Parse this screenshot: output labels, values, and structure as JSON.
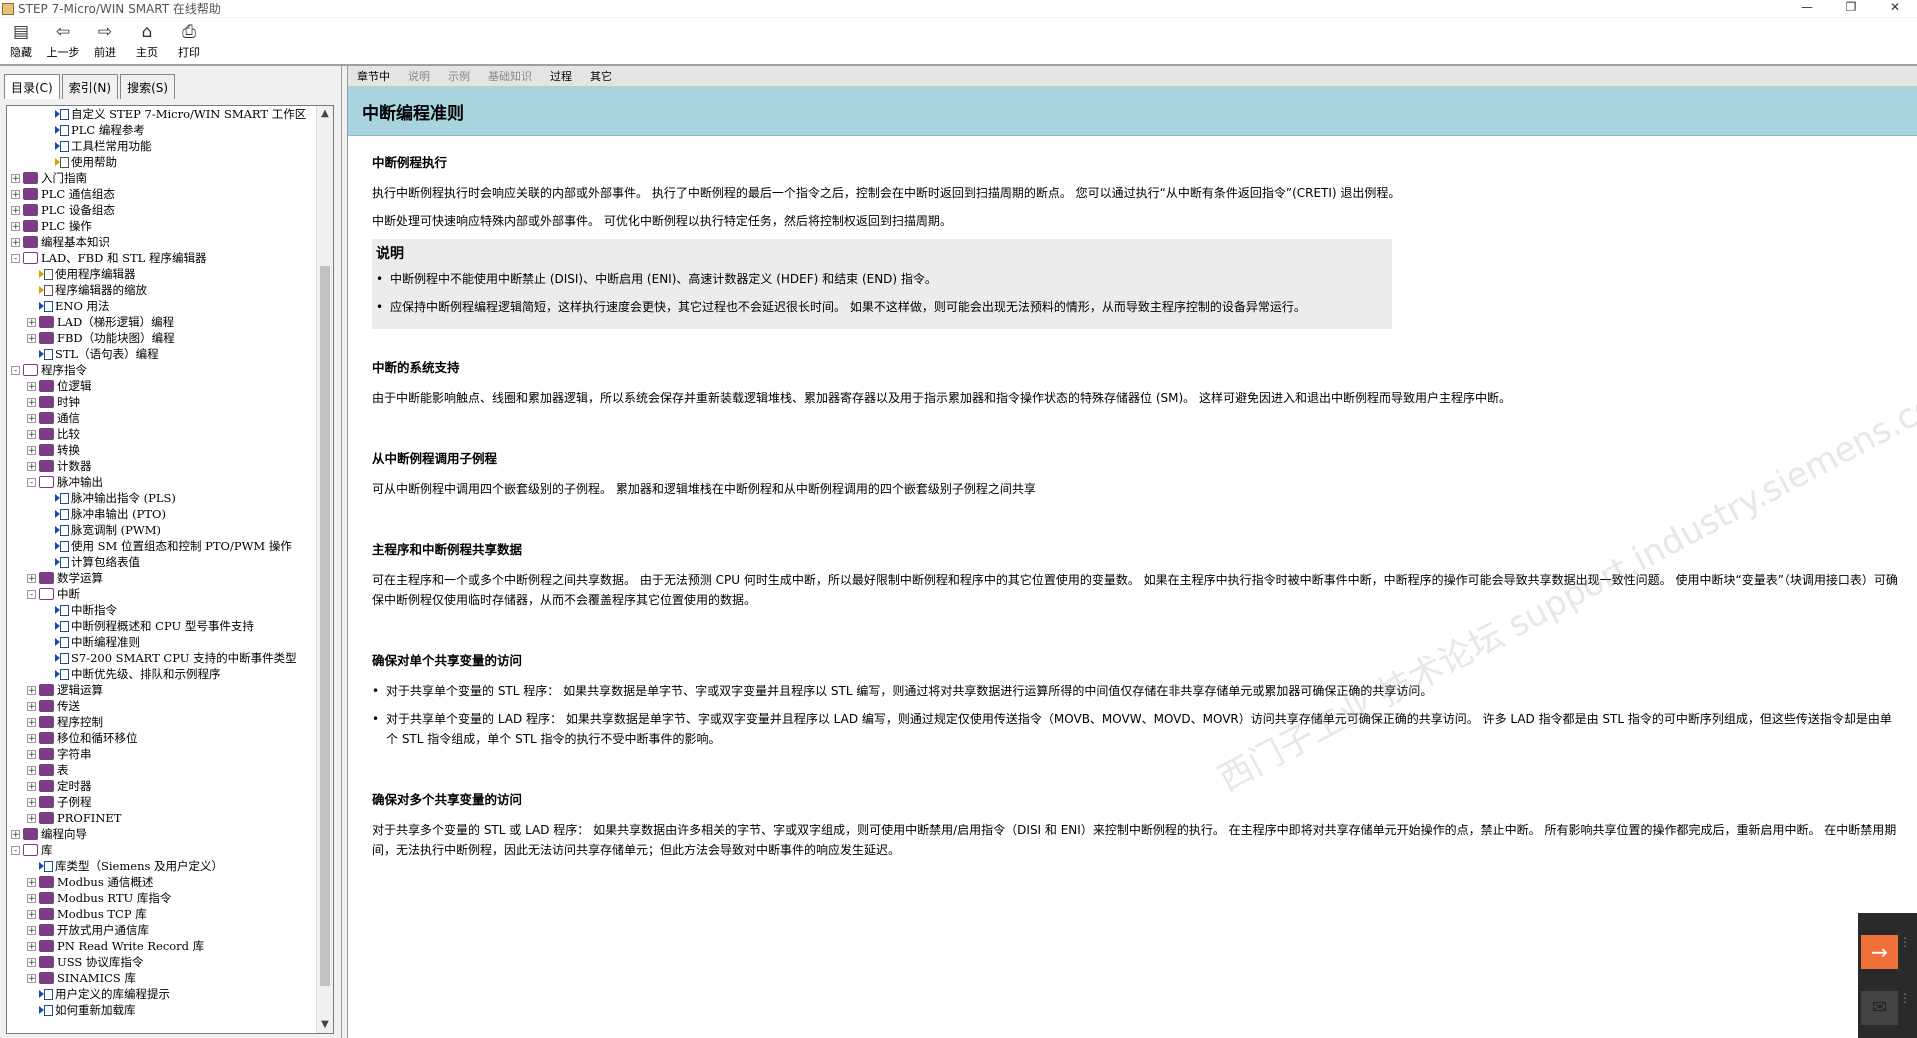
{
  "window": {
    "title": "STEP 7-Micro/WIN SMART 在线帮助",
    "controls": [
      "—",
      "❐",
      "✕"
    ]
  },
  "toolbar": {
    "buttons": [
      {
        "label": "隐藏",
        "icon": "hide-icon"
      },
      {
        "label": "上一步",
        "icon": "back-icon"
      },
      {
        "label": "前进",
        "icon": "forward-icon"
      },
      {
        "label": "主页",
        "icon": "home-icon"
      },
      {
        "label": "打印",
        "icon": "print-icon"
      }
    ]
  },
  "left_tabs": [
    "目录(C)",
    "索引(N)",
    "搜索(S)"
  ],
  "tree": [
    {
      "level": 3,
      "type": "page",
      "exp": "",
      "label": "自定义 STEP 7-Micro/WIN SMART 工作区"
    },
    {
      "level": 3,
      "type": "page",
      "exp": "",
      "label": "PLC 编程参考"
    },
    {
      "level": 3,
      "type": "page",
      "exp": "",
      "label": "工具栏常用功能"
    },
    {
      "level": 3,
      "type": "yellow",
      "exp": "",
      "label": "使用帮助"
    },
    {
      "level": 1,
      "type": "book",
      "exp": "+",
      "label": "入门指南"
    },
    {
      "level": 1,
      "type": "book",
      "exp": "+",
      "label": "PLC 通信组态"
    },
    {
      "level": 1,
      "type": "book",
      "exp": "+",
      "label": "PLC 设备组态"
    },
    {
      "level": 1,
      "type": "book",
      "exp": "+",
      "label": "PLC 操作"
    },
    {
      "level": 1,
      "type": "book",
      "exp": "+",
      "label": "编程基本知识"
    },
    {
      "level": 1,
      "type": "openbook",
      "exp": "-",
      "label": "LAD、FBD 和 STL 程序编辑器"
    },
    {
      "level": 2,
      "type": "yellow",
      "exp": "",
      "label": "使用程序编辑器"
    },
    {
      "level": 2,
      "type": "yellow",
      "exp": "",
      "label": "程序编辑器的缩放"
    },
    {
      "level": 2,
      "type": "page",
      "exp": "",
      "label": "ENO 用法"
    },
    {
      "level": 2,
      "type": "book",
      "exp": "+",
      "label": "LAD（梯形逻辑）编程"
    },
    {
      "level": 2,
      "type": "book",
      "exp": "+",
      "label": "FBD（功能块图）编程"
    },
    {
      "level": 2,
      "type": "page",
      "exp": "",
      "label": "STL（语句表）编程"
    },
    {
      "level": 1,
      "type": "openbook",
      "exp": "-",
      "label": "程序指令"
    },
    {
      "level": 2,
      "type": "book",
      "exp": "+",
      "label": "位逻辑"
    },
    {
      "level": 2,
      "type": "book",
      "exp": "+",
      "label": "时钟"
    },
    {
      "level": 2,
      "type": "book",
      "exp": "+",
      "label": "通信"
    },
    {
      "level": 2,
      "type": "book",
      "exp": "+",
      "label": "比较"
    },
    {
      "level": 2,
      "type": "book",
      "exp": "+",
      "label": "转换"
    },
    {
      "level": 2,
      "type": "book",
      "exp": "+",
      "label": "计数器"
    },
    {
      "level": 2,
      "type": "openbook",
      "exp": "-",
      "label": "脉冲输出"
    },
    {
      "level": 3,
      "type": "page",
      "exp": "",
      "label": "脉冲输出指令 (PLS)"
    },
    {
      "level": 3,
      "type": "page",
      "exp": "",
      "label": "脉冲串输出 (PTO)"
    },
    {
      "level": 3,
      "type": "page",
      "exp": "",
      "label": "脉宽调制 (PWM)"
    },
    {
      "level": 3,
      "type": "page",
      "exp": "",
      "label": "使用 SM 位置组态和控制 PTO/PWM 操作"
    },
    {
      "level": 3,
      "type": "page",
      "exp": "",
      "label": "计算包络表值"
    },
    {
      "level": 2,
      "type": "book",
      "exp": "+",
      "label": "数学运算"
    },
    {
      "level": 2,
      "type": "openbook",
      "exp": "-",
      "label": "中断"
    },
    {
      "level": 3,
      "type": "page",
      "exp": "",
      "label": "中断指令"
    },
    {
      "level": 3,
      "type": "page",
      "exp": "",
      "label": "中断例程概述和 CPU 型号事件支持"
    },
    {
      "level": 3,
      "type": "page",
      "exp": "",
      "label": "中断编程准则"
    },
    {
      "level": 3,
      "type": "page",
      "exp": "",
      "label": "S7-200 SMART CPU 支持的中断事件类型"
    },
    {
      "level": 3,
      "type": "page",
      "exp": "",
      "label": "中断优先级、排队和示例程序"
    },
    {
      "level": 2,
      "type": "book",
      "exp": "+",
      "label": "逻辑运算"
    },
    {
      "level": 2,
      "type": "book",
      "exp": "+",
      "label": "传送"
    },
    {
      "level": 2,
      "type": "book",
      "exp": "+",
      "label": "程序控制"
    },
    {
      "level": 2,
      "type": "book",
      "exp": "+",
      "label": "移位和循环移位"
    },
    {
      "level": 2,
      "type": "book",
      "exp": "+",
      "label": "字符串"
    },
    {
      "level": 2,
      "type": "book",
      "exp": "+",
      "label": "表"
    },
    {
      "level": 2,
      "type": "book",
      "exp": "+",
      "label": "定时器"
    },
    {
      "level": 2,
      "type": "book",
      "exp": "+",
      "label": "子例程"
    },
    {
      "level": 2,
      "type": "book",
      "exp": "+",
      "label": "PROFINET"
    },
    {
      "level": 1,
      "type": "book",
      "exp": "+",
      "label": "编程向导"
    },
    {
      "level": 1,
      "type": "openbook",
      "exp": "-",
      "label": "库"
    },
    {
      "level": 2,
      "type": "page",
      "exp": "",
      "label": "库类型（Siemens 及用户定义）"
    },
    {
      "level": 2,
      "type": "book",
      "exp": "+",
      "label": "Modbus 通信概述"
    },
    {
      "level": 2,
      "type": "book",
      "exp": "+",
      "label": "Modbus RTU 库指令"
    },
    {
      "level": 2,
      "type": "book",
      "exp": "+",
      "label": "Modbus TCP 库"
    },
    {
      "level": 2,
      "type": "book",
      "exp": "+",
      "label": "开放式用户通信库"
    },
    {
      "level": 2,
      "type": "book",
      "exp": "+",
      "label": "PN Read Write Record 库"
    },
    {
      "level": 2,
      "type": "book",
      "exp": "+",
      "label": "USS 协议库指令"
    },
    {
      "level": 2,
      "type": "book",
      "exp": "+",
      "label": "SINAMICS 库"
    },
    {
      "level": 2,
      "type": "page",
      "exp": "",
      "label": "用户定义的库编程提示"
    },
    {
      "level": 2,
      "type": "page",
      "exp": "",
      "label": "如何重新加载库"
    }
  ],
  "content_tabs": [
    {
      "label": "章节中",
      "active": true
    },
    {
      "label": "说明",
      "active": false
    },
    {
      "label": "示例",
      "active": false
    },
    {
      "label": "基础知识",
      "active": false
    },
    {
      "label": "过程",
      "active": true
    },
    {
      "label": "其它",
      "active": true
    }
  ],
  "page_title": "中断编程准则",
  "sections": {
    "s1_title": "中断例程执行",
    "s1_p1": "执行中断例程执行时会响应关联的内部或外部事件。 执行了中断例程的最后一个指令之后，控制会在中断时返回到扫描周期的断点。 您可以通过执行“从中断有条件返回指令”(CRETI) 退出例程。",
    "s1_p2": "中断处理可快速响应特殊内部或外部事件。 可优化中断例程以执行特定任务，然后将控制权返回到扫描周期。",
    "note_title": "说明",
    "note_1": "中断例程中不能使用中断禁止 (DISI)、中断启用 (ENI)、高速计数器定义 (HDEF) 和结束 (END) 指令。",
    "note_2": "应保持中断例程编程逻辑简短，这样执行速度会更快，其它过程也不会延迟很长时间。 如果不这样做，则可能会出现无法预料的情形，从而导致主程序控制的设备异常运行。",
    "s2_title": "中断的系统支持",
    "s2_p1": "由于中断能影响触点、线圈和累加器逻辑，所以系统会保存并重新装载逻辑堆栈、累加器寄存器以及用于指示累加器和指令操作状态的特殊存储器位 (SM)。 这样可避免因进入和退出中断例程而导致用户主程序中断。",
    "s3_title": "从中断例程调用子例程",
    "s3_p1": "可从中断例程中调用四个嵌套级别的子例程。 累加器和逻辑堆栈在中断例程和从中断例程调用的四个嵌套级别子例程之间共享",
    "s4_title": "主程序和中断例程共享数据",
    "s4_p1": "可在主程序和一个或多个中断例程之间共享数据。 由于无法预测 CPU 何时生成中断，所以最好限制中断例程和程序中的其它位置使用的变量数。 如果在主程序中执行指令时被中断事件中断，中断程序的操作可能会导致共享数据出现一致性问题。 使用中断块“变量表”（块调用接口表）可确保中断例程仅使用临时存储器，从而不会覆盖程序其它位置使用的数据。",
    "s5_title": "确保对单个共享变量的访问",
    "s5_b1": "对于共享单个变量的 STL 程序： 如果共享数据是单字节、字或双字变量并且程序以 STL 编写，则通过将对共享数据进行运算所得的中间值仅存储在非共享存储单元或累加器可确保正确的共享访问。",
    "s5_b2": "对于共享单个变量的 LAD 程序： 如果共享数据是单字节、字或双字变量并且程序以 LAD 编写，则通过规定仅使用传送指令（MOVB、MOVW、MOVD、MOVR）访问共享存储单元可确保正确的共享访问。 许多 LAD 指令都是由 STL 指令的可中断序列组成，但这些传送指令却是由单个 STL 指令组成，单个 STL 指令的执行不受中断事件的影响。",
    "s6_title": "确保对多个共享变量的访问",
    "s6_p1": "对于共享多个变量的 STL 或 LAD 程序： 如果共享数据由许多相关的字节、字或双字组成，则可使用中断禁用/启用指令（DISI 和 ENI）来控制中断例程的执行。 在主程序中即将对共享存储单元开始操作的点，禁止中断。 所有影响共享位置的操作都完成后，重新启用中断。 在中断禁用期间，无法执行中断例程，因此无法访问共享存储单元；但此方法会导致对中断事件的响应发生延迟。"
  },
  "watermark": "西门子工业 技术论坛 support.industry.siemens.com/cs",
  "float_panel": {
    "arrow_icon": "→",
    "chat_icon": "✉"
  }
}
